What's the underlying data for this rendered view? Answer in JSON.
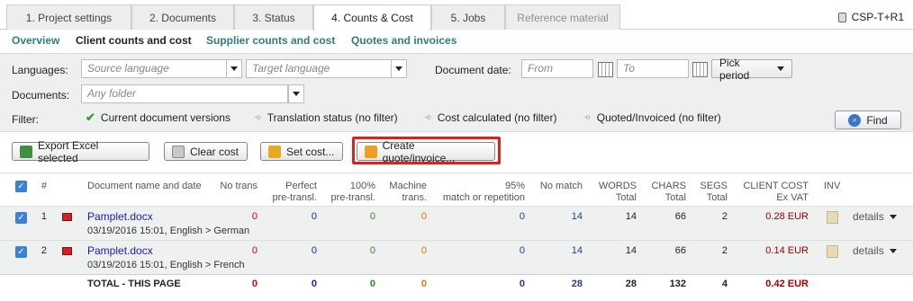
{
  "tabs": [
    {
      "label": "1. Project settings"
    },
    {
      "label": "2. Documents"
    },
    {
      "label": "3. Status"
    },
    {
      "label": "4. Counts & Cost"
    },
    {
      "label": "5. Jobs"
    },
    {
      "label": "Reference material"
    }
  ],
  "project_code": "CSP-T+R1",
  "subnav": {
    "overview": "Overview",
    "client": "Client counts and cost",
    "supplier": "Supplier counts and cost",
    "quotes": "Quotes and invoices"
  },
  "filters": {
    "languages_label": "Languages:",
    "source_placeholder": "Source language",
    "target_placeholder": "Target language",
    "document_date_label": "Document date:",
    "from_placeholder": "From",
    "to_placeholder": "To",
    "pick_period": "Pick period",
    "documents_label": "Documents:",
    "folder_placeholder": "Any folder",
    "filter_label": "Filter:",
    "current_versions": "Current document versions",
    "translation_status": "Translation status (no filter)",
    "cost_calculated": "Cost calculated (no filter)",
    "quoted_invoiced": "Quoted/Invoiced (no filter)",
    "find": "Find"
  },
  "actions": {
    "export": "Export Excel selected",
    "clear": "Clear cost",
    "set": "Set cost...",
    "create": "Create quote/invoice..."
  },
  "columns": {
    "num": "#",
    "doc": "Document name and date",
    "no_trans": "No trans",
    "perfect_1": "Perfect",
    "perfect_2": "pre-transl.",
    "h100_1": "100%",
    "h100_2": "pre-transl.",
    "machine_1": "Machine",
    "machine_2": "trans.",
    "h95_1": "95%",
    "h95_2": "match or repetition",
    "no_match": "No match",
    "words_1": "WORDS",
    "words_2": "Total",
    "chars_1": "CHARS",
    "chars_2": "Total",
    "segs_1": "SEGS",
    "segs_2": "Total",
    "cost_1": "CLIENT COST",
    "cost_2": "Ex VAT",
    "inv": "INV"
  },
  "rows": [
    {
      "num": "1",
      "name": "Pamplet.docx",
      "sub": "03/19/2016 15:01, English > German",
      "no_trans": "0",
      "perfect": "0",
      "p100": "0",
      "machine": "0",
      "p95": "0",
      "no_match": "14",
      "words": "14",
      "chars": "66",
      "segs": "2",
      "cost": "0.28 EUR",
      "details": "details"
    },
    {
      "num": "2",
      "name": "Pamplet.docx",
      "sub": "03/19/2016 15:01, English > French",
      "no_trans": "0",
      "perfect": "0",
      "p100": "0",
      "machine": "0",
      "p95": "0",
      "no_match": "14",
      "words": "14",
      "chars": "66",
      "segs": "2",
      "cost": "0.14 EUR",
      "details": "details"
    }
  ],
  "totals": {
    "label": "TOTAL - THIS PAGE",
    "no_trans": "0",
    "perfect": "0",
    "p100": "0",
    "machine": "0",
    "p95": "0",
    "no_match": "28",
    "words": "28",
    "chars": "132",
    "segs": "4",
    "cost": "0.42 EUR"
  }
}
